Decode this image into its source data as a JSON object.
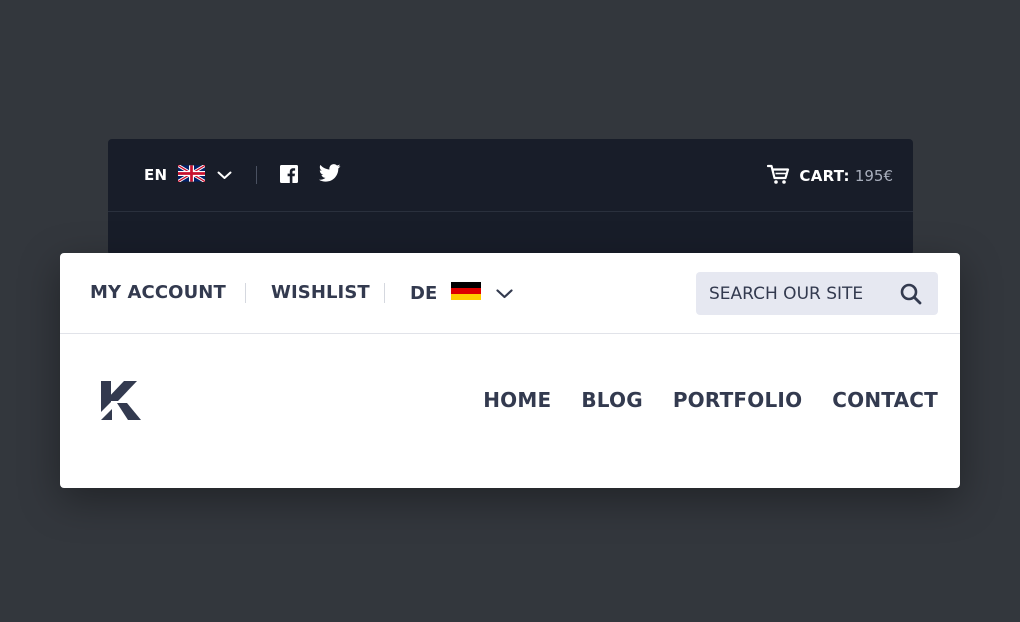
{
  "colors": {
    "page_bg": "#33373d",
    "dark_bar_bg": "#181d29",
    "card_bg": "#ffffff",
    "text_primary": "#333a4f",
    "search_bg": "#e6e8f1",
    "cart_amount": "#a9afbd"
  },
  "top_bar": {
    "language": {
      "code": "EN",
      "flag_icon": "uk-flag-icon",
      "dropdown_icon": "chevron-down-icon"
    },
    "social": [
      {
        "name": "facebook",
        "icon": "facebook-icon"
      },
      {
        "name": "twitter",
        "icon": "twitter-icon"
      }
    ],
    "cart": {
      "icon": "shopping-cart-icon",
      "label": "CART:",
      "amount": "195€"
    }
  },
  "utility_bar": {
    "my_account": "MY ACCOUNT",
    "wishlist": "WISHLIST",
    "language": {
      "code": "DE",
      "flag_icon": "germany-flag-icon",
      "dropdown_icon": "chevron-down-icon"
    },
    "search": {
      "placeholder": "SEARCH OUR SITE",
      "icon": "search-icon"
    }
  },
  "header": {
    "logo_icon": "k-logo-icon",
    "nav": [
      {
        "label": "HOME"
      },
      {
        "label": "BLOG"
      },
      {
        "label": "PORTFOLIO"
      },
      {
        "label": "CONTACT"
      }
    ]
  }
}
